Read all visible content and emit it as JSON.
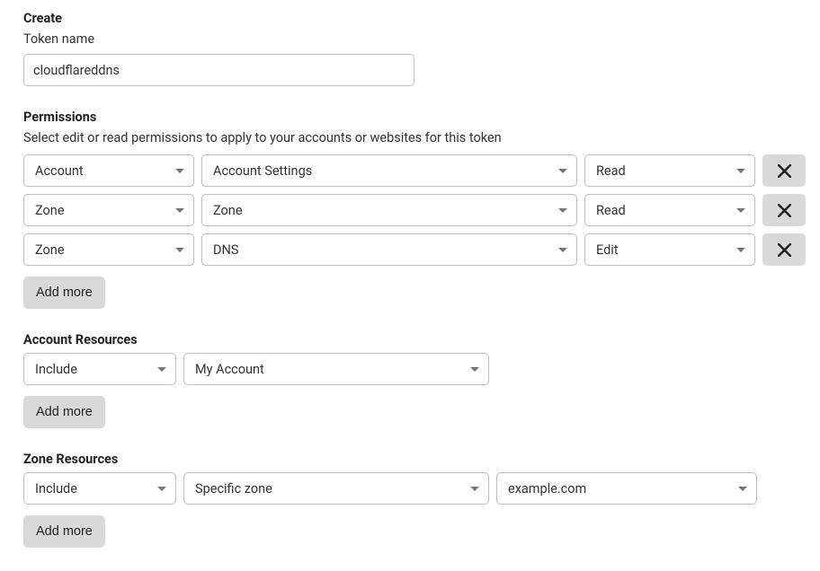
{
  "create": {
    "heading": "Create",
    "token_name_label": "Token name",
    "token_name_value": "cloudflareddns"
  },
  "permissions": {
    "heading": "Permissions",
    "description": "Select edit or read permissions to apply to your accounts or websites for this token",
    "rows": [
      {
        "scope": "Account",
        "resource": "Account Settings",
        "level": "Read"
      },
      {
        "scope": "Zone",
        "resource": "Zone",
        "level": "Read"
      },
      {
        "scope": "Zone",
        "resource": "DNS",
        "level": "Edit"
      }
    ],
    "add_more": "Add more"
  },
  "account_resources": {
    "heading": "Account Resources",
    "rows": [
      {
        "mode": "Include",
        "account": "My Account"
      }
    ],
    "add_more": "Add more"
  },
  "zone_resources": {
    "heading": "Zone Resources",
    "rows": [
      {
        "mode": "Include",
        "zone_scope": "Specific zone",
        "zone": "example.com"
      }
    ],
    "add_more": "Add more"
  }
}
